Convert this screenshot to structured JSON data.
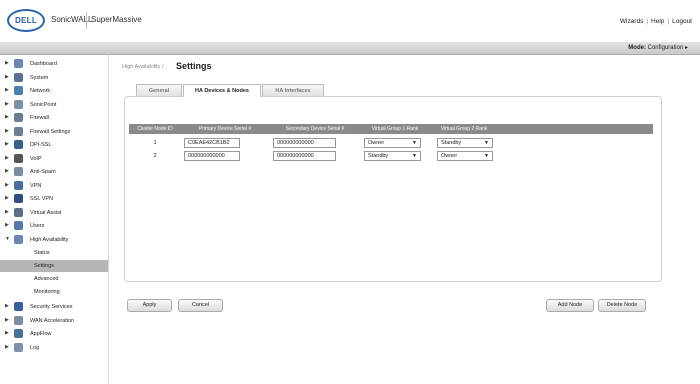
{
  "header": {
    "logo_text": "DELL",
    "brand": "SonicWALL",
    "product": "SuperMassive",
    "links": [
      "Wizards",
      "Help",
      "Logout"
    ],
    "link_separator": "|"
  },
  "modebar": {
    "mode_label": "Mode:",
    "mode_value": "Configuration ▸"
  },
  "sidebar": {
    "items": [
      {
        "label": "Dashboard",
        "icon": "dashboard-icon",
        "color": "#6a86b4"
      },
      {
        "label": "System",
        "icon": "monitor-icon",
        "color": "#5a6f92"
      },
      {
        "label": "Network",
        "icon": "network-globe-icon",
        "color": "#4d7fb0"
      },
      {
        "label": "SonicPoint",
        "icon": "access-point-icon",
        "color": "#7a8fa8"
      },
      {
        "label": "Firewall",
        "icon": "firewall-icon",
        "color": "#6d7d91"
      },
      {
        "label": "Firewall Settings",
        "icon": "firewall-settings-icon",
        "color": "#6d7d91"
      },
      {
        "label": "DPI-SSL",
        "icon": "dpi-ssl-icon",
        "color": "#3b5f8c"
      },
      {
        "label": "VoIP",
        "icon": "phone-icon",
        "color": "#555555"
      },
      {
        "label": "Anti-Spam",
        "icon": "anti-spam-icon",
        "color": "#7b8ba0"
      },
      {
        "label": "VPN",
        "icon": "vpn-globe-icon",
        "color": "#4a6f9a"
      },
      {
        "label": "SSL VPN",
        "icon": "ssl-vpn-icon",
        "color": "#2e4f7d"
      },
      {
        "label": "Virtual Assist",
        "icon": "virtual-assist-icon",
        "color": "#5b6e8a"
      },
      {
        "label": "Users",
        "icon": "users-icon",
        "color": "#5a79a6"
      },
      {
        "label": "High Availability",
        "icon": "high-availability-icon",
        "color": "#6a86b4"
      }
    ],
    "sub_items": [
      "Status",
      "Settings",
      "Advanced",
      "Monitoring"
    ],
    "active_sub": "Settings",
    "items_after": [
      {
        "label": "Security Services",
        "icon": "security-shield-icon",
        "color": "#3b5f9c"
      },
      {
        "label": "WAN Acceleration",
        "icon": "wan-acceleration-icon",
        "color": "#7c8ca2"
      },
      {
        "label": "AppFlow",
        "icon": "appflow-icon",
        "color": "#4a6f9a"
      },
      {
        "label": "Log",
        "icon": "log-icon",
        "color": "#8090a6"
      }
    ]
  },
  "page": {
    "breadcrumb": "High Availability /",
    "title": "Settings"
  },
  "tabs": [
    "General",
    "HA Devices & Nodes",
    "HA Interfaces"
  ],
  "active_tab": "HA Devices & Nodes",
  "table": {
    "columns": [
      "Cluster Node ID",
      "Primary Device Serial #",
      "Secondary Device Serial #",
      "Virtual Group 1 Rank",
      "Virtual Group 2 Rank"
    ],
    "rows": [
      {
        "id": "1",
        "primary": "C0EAE42CB1B2",
        "secondary": "000000000000",
        "vg1": "Owner",
        "vg2": "Standby"
      },
      {
        "id": "2",
        "primary": "000000000000",
        "secondary": "000000000000",
        "vg1": "Standby",
        "vg2": "Owner"
      }
    ]
  },
  "buttons": {
    "apply": "Apply",
    "cancel": "Cancel",
    "add_node": "Add Node",
    "delete_node": "Delete Node"
  },
  "colors": {
    "accent": "#2b64a7",
    "header_table": "#8a8a8a",
    "active_sidebar": "#b6b6b6"
  }
}
